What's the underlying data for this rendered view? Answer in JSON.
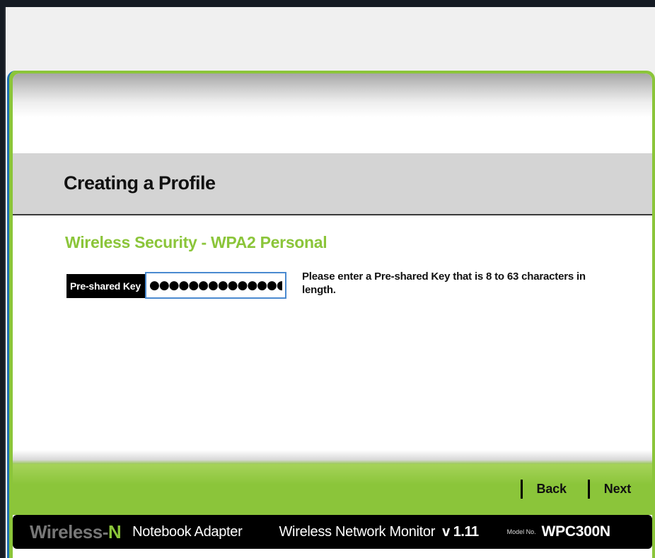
{
  "page": {
    "title": "Creating a Profile",
    "section_heading": "Wireless Security - WPA2 Personal"
  },
  "form": {
    "key_label": "Pre-shared Key",
    "key_value": "●●●●●●●●●●●●●●●",
    "help_text": "Please enter a Pre-shared Key that is 8 to 63 characters in length."
  },
  "nav": {
    "back_label": "Back",
    "next_label": "Next"
  },
  "footer": {
    "brand_wireless": "Wireless-",
    "brand_n": "N",
    "product": "Notebook Adapter",
    "monitor": "Wireless Network Monitor",
    "version": "v 1.11",
    "model_prefix": "Model No.",
    "model_number": "WPC300N"
  },
  "colors": {
    "accent_green": "#8bc53a",
    "title_band": "#d4d4d4",
    "input_border": "#4a8ad0",
    "background_dark": "#151b23"
  }
}
